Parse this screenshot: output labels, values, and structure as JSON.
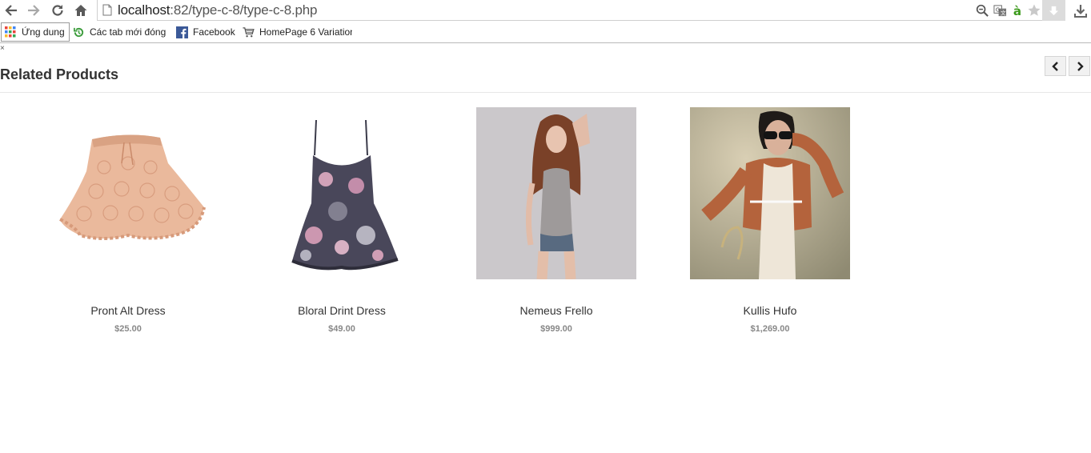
{
  "browser": {
    "url_host": "localhost",
    "url_path": ":82/type-c-8/type-c-8.php",
    "nav_icons": [
      "back-icon",
      "forward-icon",
      "reload-icon",
      "home-icon"
    ],
    "right_icons": [
      "zoom-icon",
      "translate-icon",
      "extension-a-icon",
      "star-icon",
      "extension-download-icon",
      "download-icon"
    ],
    "bookmarks": [
      {
        "label": "Ứng dung",
        "icon": "apps-grid-icon"
      },
      {
        "label": "Các tab mới đóng",
        "icon": "recent-tabs-icon"
      },
      {
        "label": "Facebook",
        "icon": "facebook-icon"
      },
      {
        "label": "HomePage 6 Variation",
        "icon": "cart-icon"
      }
    ]
  },
  "page": {
    "close_mark": "×",
    "section_title": "Related Products",
    "products": [
      {
        "name": "Pront Alt Dress",
        "price": "$25.00",
        "image": "crochet-skirt"
      },
      {
        "name": "Bloral Drint Dress",
        "price": "$49.00",
        "image": "floral-dress"
      },
      {
        "name": "Nemeus Frello",
        "price": "$999.00",
        "image": "model-grey-top"
      },
      {
        "name": "Kullis Hufo",
        "price": "$1,269.00",
        "image": "model-sunglasses"
      }
    ]
  },
  "colors": {
    "title": "#333333",
    "price": "#888888",
    "skirt": "#e9b99a",
    "jacket": "#b4633c"
  }
}
